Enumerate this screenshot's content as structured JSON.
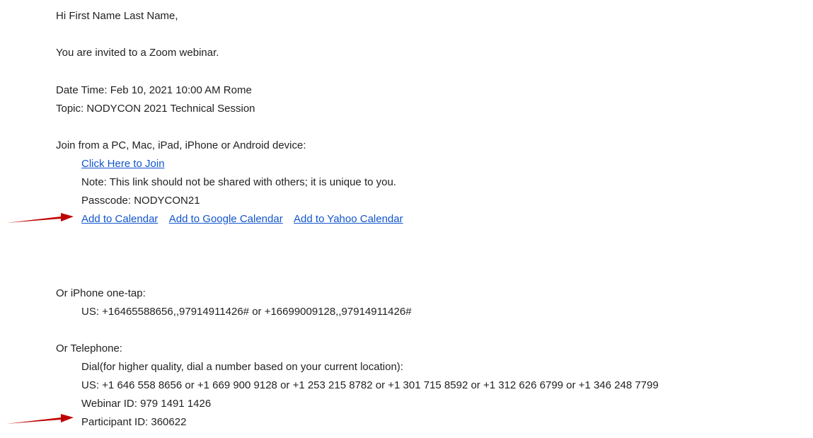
{
  "greeting": "Hi First Name Last Name,",
  "invite_text": "You are invited to a Zoom webinar.",
  "date_time": "Date Time: Feb 10, 2021 10:00 AM Rome",
  "topic": "Topic: NODYCON 2021 Technical Session",
  "join": {
    "heading": "Join from a PC, Mac, iPad, iPhone or Android device:",
    "link_label": "Click Here to Join",
    "note": "Note: This link should not be shared with others; it is unique to you.",
    "passcode": "Passcode: NODYCON21",
    "calendar_links": [
      "Add to Calendar",
      "Add to Google Calendar",
      "Add to Yahoo Calendar"
    ]
  },
  "iphone": {
    "heading": "Or iPhone one-tap:",
    "numbers": "US: +16465588656,,97914911426# or +16699009128,,97914911426#"
  },
  "telephone": {
    "heading": "Or Telephone:",
    "dial_note": "Dial(for higher quality, dial a number based on your current location):",
    "numbers": "US: +1 646 558 8656 or +1 669 900 9128 or +1 253 215 8782 or +1 301 715 8592 or +1 312 626 6799 or +1 346 248 7799",
    "webinar_id": "Webinar ID: 979 1491 1426",
    "participant_id": "Participant ID: 360622"
  },
  "colors": {
    "link": "#1155cc",
    "text": "#222222",
    "arrow": "#c00000"
  }
}
